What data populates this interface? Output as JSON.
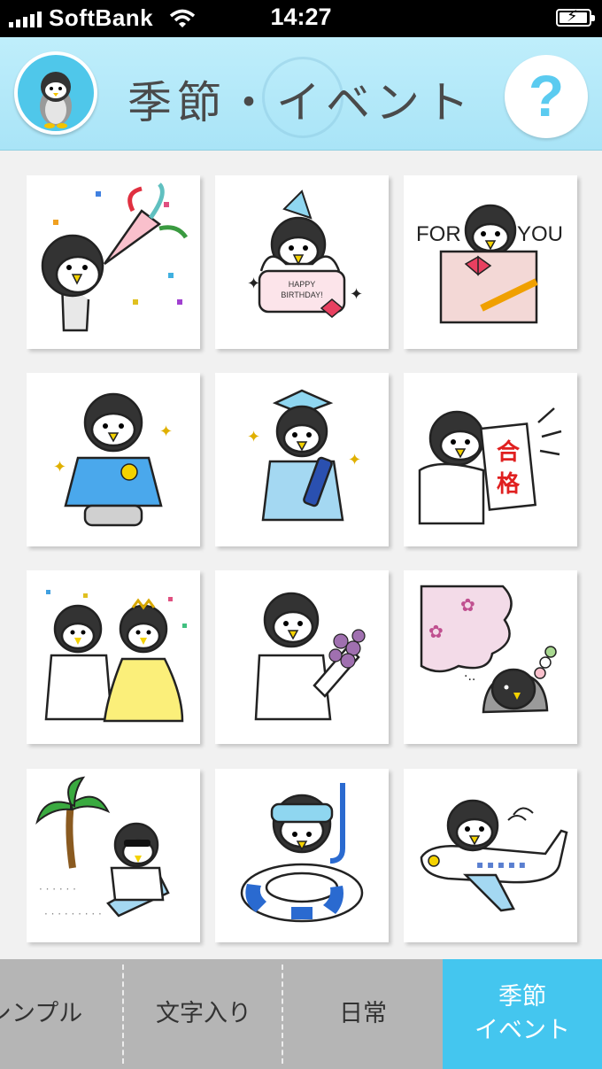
{
  "status_bar": {
    "carrier": "SoftBank",
    "time": "14:27"
  },
  "header": {
    "title": "季節・イベント",
    "help_label": "?"
  },
  "stickers": [
    {
      "name": "party-cracker-sticker"
    },
    {
      "name": "birthday-cake-sticker",
      "text": "HAPPY BIRTHDAY!"
    },
    {
      "name": "for-you-gift-sticker",
      "text_left": "FOR",
      "text_right": "YOU"
    },
    {
      "name": "entrance-ceremony-sticker"
    },
    {
      "name": "graduation-sticker"
    },
    {
      "name": "exam-pass-sticker",
      "text": "合格"
    },
    {
      "name": "wedding-sticker"
    },
    {
      "name": "bouquet-sticker"
    },
    {
      "name": "cherry-blossom-sticker"
    },
    {
      "name": "beach-sticker"
    },
    {
      "name": "swim-ring-sticker"
    },
    {
      "name": "airplane-sticker"
    }
  ],
  "tabs": [
    {
      "label": "シンプル",
      "active": false
    },
    {
      "label": "文字入り",
      "active": false
    },
    {
      "label": "日常",
      "active": false
    },
    {
      "label": "季節\nイベント",
      "active": true
    }
  ],
  "colors": {
    "header_bg": "#a9e4f7",
    "active_tab": "#44c6ef",
    "tabbar_bg": "#b5b5b5",
    "help_icon": "#5bcbf0"
  }
}
